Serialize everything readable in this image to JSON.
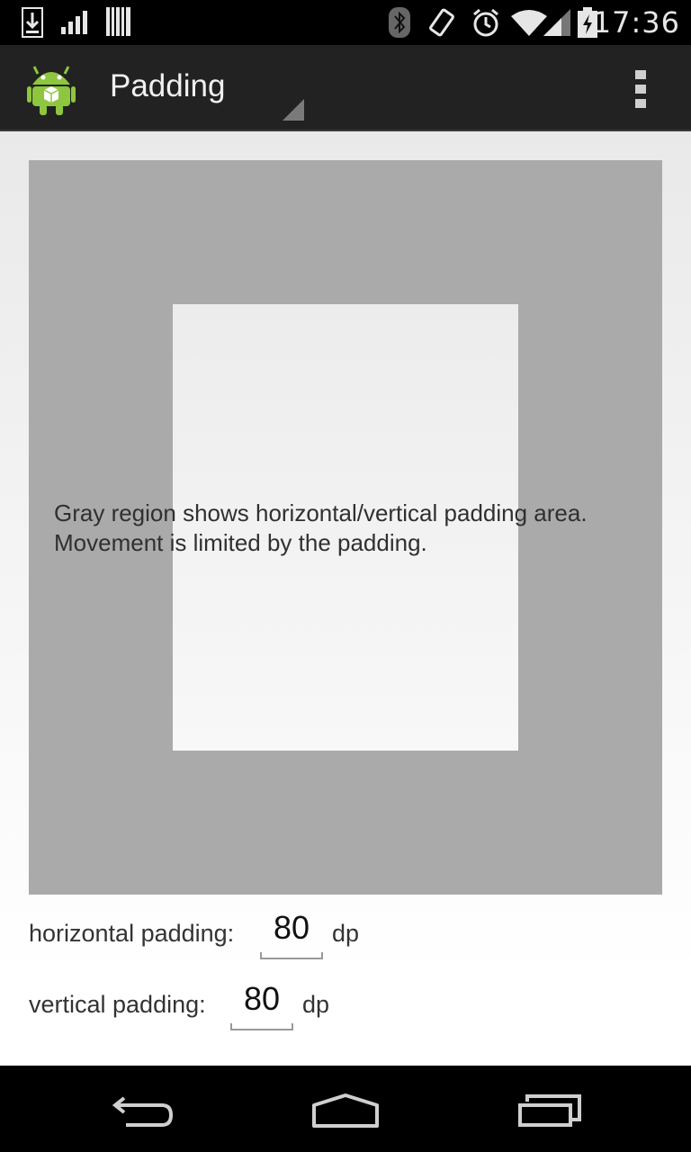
{
  "status_bar": {
    "time": "17:36",
    "icons": [
      "download-icon",
      "signal-bars-icon",
      "barcode-icon",
      "bluetooth-icon",
      "rotate-icon",
      "alarm-icon",
      "wifi-icon",
      "cell-signal-icon",
      "battery-charging-icon"
    ]
  },
  "action_bar": {
    "title": "Padding",
    "app_icon": "android-robot-icon",
    "overflow_icon": "overflow-menu-icon"
  },
  "main": {
    "description_line1": "Gray region shows horizontal/vertical padding area.",
    "description_line2": "Movement is limited by the padding.",
    "colors": {
      "padding_area": "#aaaaaa",
      "movable_area": "#f0f0f0"
    }
  },
  "controls": {
    "horizontal": {
      "label": "horizontal padding:",
      "value": "80",
      "unit": "dp"
    },
    "vertical": {
      "label": "vertical padding:",
      "value": "80",
      "unit": "dp"
    }
  },
  "nav_bar": {
    "back_icon": "back-icon",
    "home_icon": "home-icon",
    "recents_icon": "recent-apps-icon"
  }
}
